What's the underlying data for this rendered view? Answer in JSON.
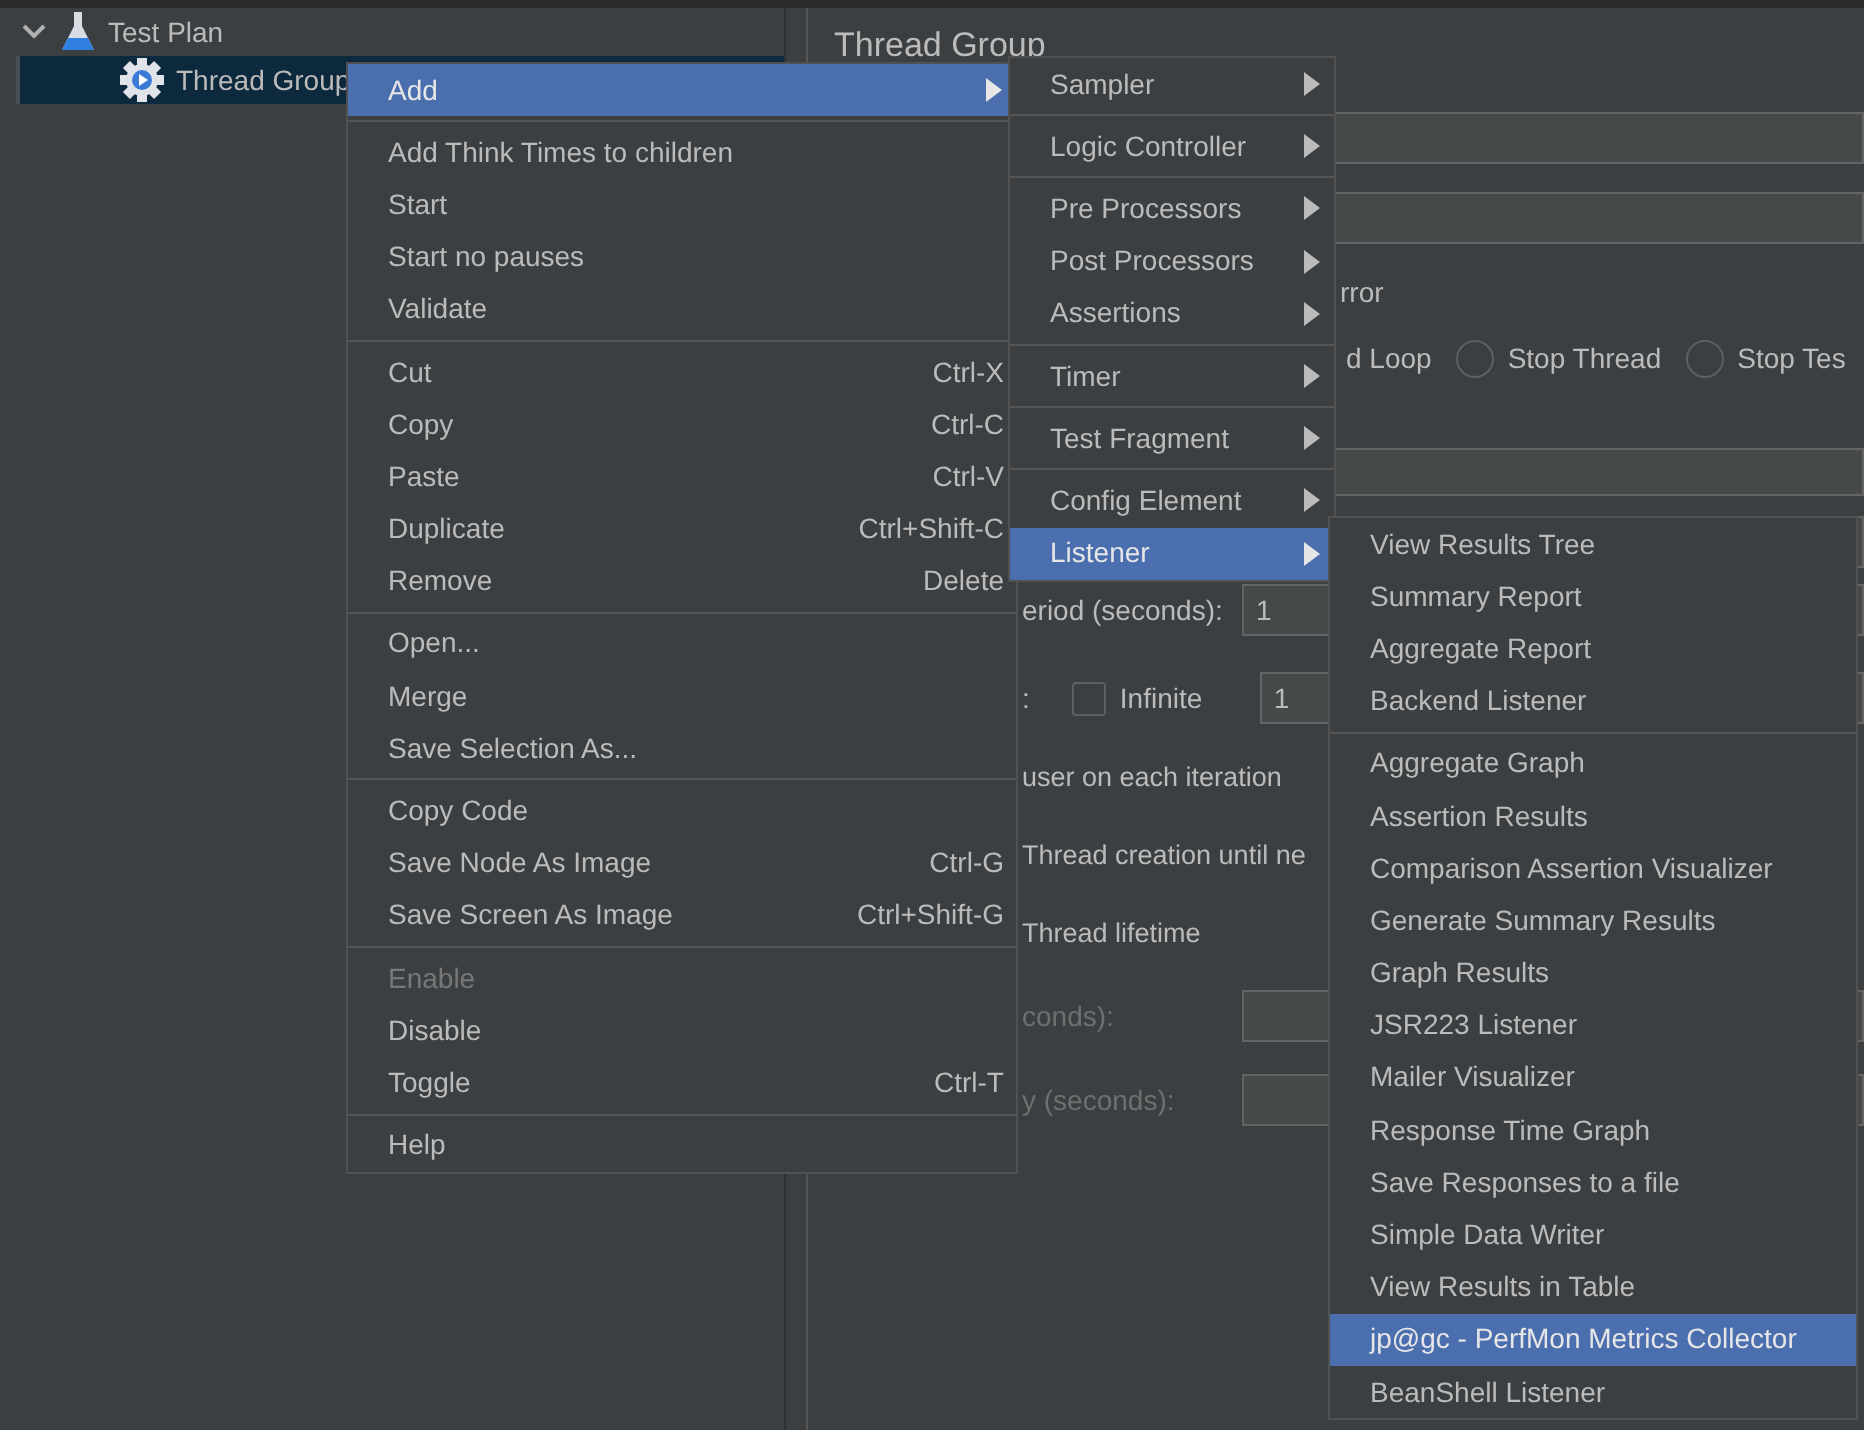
{
  "tree": [
    {
      "label": "Test Plan",
      "expanded": true,
      "selected": false,
      "children": [
        {
          "label": "Thread Group",
          "selected": true
        }
      ]
    }
  ],
  "panel": {
    "title": "Thread Group",
    "rows": [
      {
        "kind": "field"
      },
      {
        "kind": "field"
      },
      {
        "kind": "legend",
        "label": "rror"
      },
      {
        "kind": "radios",
        "options": [
          {
            "label": "d Loop"
          },
          {
            "label": "Stop Thread",
            "selected": false
          },
          {
            "label": "Stop Tes",
            "selected": false
          }
        ]
      },
      {
        "kind": "field"
      },
      {
        "kind": "field"
      },
      {
        "kind": "labeled_field",
        "label": "eriod (seconds):",
        "value": "1",
        "disabled": false
      },
      {
        "kind": "checkbox_field",
        "label": ":",
        "checkbox": "Infinite",
        "checked": false,
        "value": "1"
      },
      {
        "kind": "text",
        "label": "user on each iteration",
        "disabled": false
      },
      {
        "kind": "text",
        "label": "Thread creation until ne",
        "disabled": false
      },
      {
        "kind": "text",
        "label": "Thread lifetime",
        "disabled": false
      },
      {
        "kind": "labeled_field",
        "label": "conds):",
        "value": "",
        "disabled": true
      },
      {
        "kind": "labeled_field",
        "label": "y (seconds):",
        "value": "",
        "disabled": true
      }
    ]
  },
  "context_menu": {
    "groups": [
      {
        "items": [
          {
            "label": "Add",
            "submenu": true,
            "selected": true,
            "disabled": false
          }
        ]
      },
      {
        "items": [
          {
            "label": "Add Think Times to children",
            "submenu": false,
            "selected": false,
            "disabled": false
          },
          {
            "label": "Start",
            "submenu": false,
            "selected": false,
            "disabled": false
          },
          {
            "label": "Start no pauses",
            "submenu": false,
            "selected": false,
            "disabled": false
          },
          {
            "label": "Validate",
            "submenu": false,
            "selected": false,
            "disabled": false
          }
        ]
      },
      {
        "items": [
          {
            "label": "Cut",
            "shortcut": "Ctrl-X",
            "submenu": false,
            "selected": false,
            "disabled": false
          },
          {
            "label": "Copy",
            "shortcut": "Ctrl-C",
            "submenu": false,
            "selected": false,
            "disabled": false
          },
          {
            "label": "Paste",
            "shortcut": "Ctrl-V",
            "submenu": false,
            "selected": false,
            "disabled": false
          },
          {
            "label": "Duplicate",
            "shortcut": "Ctrl+Shift-C",
            "submenu": false,
            "selected": false,
            "disabled": false
          },
          {
            "label": "Remove",
            "shortcut": "Delete",
            "submenu": false,
            "selected": false,
            "disabled": false
          }
        ]
      },
      {
        "items": [
          {
            "label": "Open...",
            "submenu": false,
            "selected": false,
            "disabled": false
          },
          {
            "label": "Merge",
            "submenu": false,
            "selected": false,
            "disabled": false
          },
          {
            "label": "Save Selection As...",
            "submenu": false,
            "selected": false,
            "disabled": false
          }
        ]
      },
      {
        "items": [
          {
            "label": "Copy Code",
            "submenu": false,
            "selected": false,
            "disabled": false
          },
          {
            "label": "Save Node As Image",
            "shortcut": "Ctrl-G",
            "submenu": false,
            "selected": false,
            "disabled": false
          },
          {
            "label": "Save Screen As Image",
            "shortcut": "Ctrl+Shift-G",
            "submenu": false,
            "selected": false,
            "disabled": false
          }
        ]
      },
      {
        "items": [
          {
            "label": "Enable",
            "submenu": false,
            "selected": false,
            "disabled": true
          },
          {
            "label": "Disable",
            "submenu": false,
            "selected": false,
            "disabled": false
          },
          {
            "label": "Toggle",
            "shortcut": "Ctrl-T",
            "submenu": false,
            "selected": false,
            "disabled": false
          }
        ]
      },
      {
        "items": [
          {
            "label": "Help",
            "submenu": false,
            "selected": false,
            "disabled": false
          }
        ]
      }
    ]
  },
  "add_submenu": {
    "groups": [
      {
        "items": [
          {
            "label": "Sampler",
            "submenu": true,
            "selected": false
          }
        ]
      },
      {
        "items": [
          {
            "label": "Logic Controller",
            "submenu": true,
            "selected": false
          }
        ]
      },
      {
        "items": [
          {
            "label": "Pre Processors",
            "submenu": true,
            "selected": false
          },
          {
            "label": "Post Processors",
            "submenu": true,
            "selected": false
          },
          {
            "label": "Assertions",
            "submenu": true,
            "selected": false
          }
        ]
      },
      {
        "items": [
          {
            "label": "Timer",
            "submenu": true,
            "selected": false
          }
        ]
      },
      {
        "items": [
          {
            "label": "Test Fragment",
            "submenu": true,
            "selected": false
          }
        ]
      },
      {
        "items": [
          {
            "label": "Config Element",
            "submenu": true,
            "selected": false
          },
          {
            "label": "Listener",
            "submenu": true,
            "selected": true
          }
        ]
      }
    ]
  },
  "listener_submenu": {
    "groups": [
      {
        "items": [
          {
            "label": "View Results Tree",
            "selected": false
          },
          {
            "label": "Summary Report",
            "selected": false
          },
          {
            "label": "Aggregate Report",
            "selected": false
          },
          {
            "label": "Backend Listener",
            "selected": false
          }
        ]
      },
      {
        "items": [
          {
            "label": "Aggregate Graph",
            "selected": false
          },
          {
            "label": "Assertion Results",
            "selected": false
          },
          {
            "label": "Comparison Assertion Visualizer",
            "selected": false
          },
          {
            "label": "Generate Summary Results",
            "selected": false
          },
          {
            "label": "Graph Results",
            "selected": false
          },
          {
            "label": "JSR223 Listener",
            "selected": false
          },
          {
            "label": "Mailer Visualizer",
            "selected": false
          },
          {
            "label": "Response Time Graph",
            "selected": false
          },
          {
            "label": "Save Responses to a file",
            "selected": false
          },
          {
            "label": "Simple Data Writer",
            "selected": false
          },
          {
            "label": "View Results in Table",
            "selected": false
          },
          {
            "label": "jp@gc - PerfMon Metrics Collector",
            "selected": true
          },
          {
            "label": "BeanShell Listener",
            "selected": false
          }
        ]
      }
    ]
  }
}
